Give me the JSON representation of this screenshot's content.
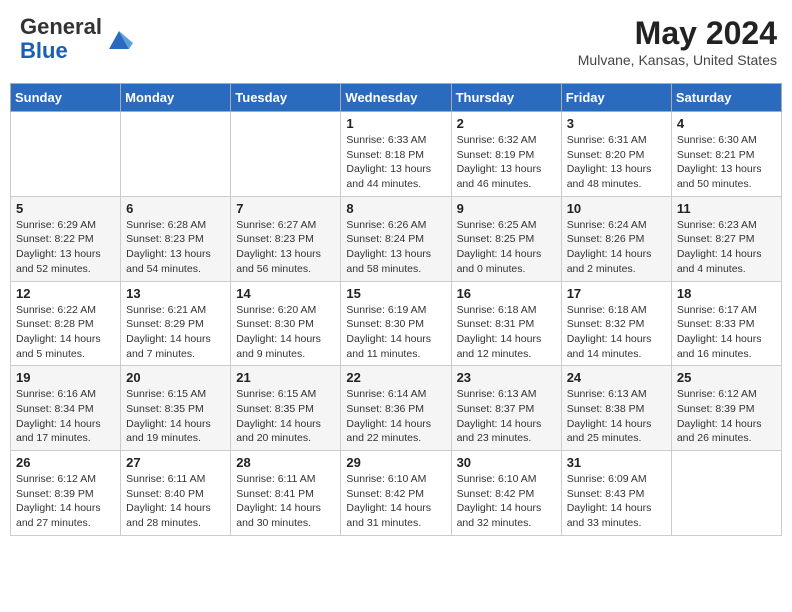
{
  "header": {
    "logo_general": "General",
    "logo_blue": "Blue",
    "month_year": "May 2024",
    "location": "Mulvane, Kansas, United States"
  },
  "weekdays": [
    "Sunday",
    "Monday",
    "Tuesday",
    "Wednesday",
    "Thursday",
    "Friday",
    "Saturday"
  ],
  "weeks": [
    [
      {
        "day": "",
        "info": ""
      },
      {
        "day": "",
        "info": ""
      },
      {
        "day": "",
        "info": ""
      },
      {
        "day": "1",
        "info": "Sunrise: 6:33 AM\nSunset: 8:18 PM\nDaylight: 13 hours\nand 44 minutes."
      },
      {
        "day": "2",
        "info": "Sunrise: 6:32 AM\nSunset: 8:19 PM\nDaylight: 13 hours\nand 46 minutes."
      },
      {
        "day": "3",
        "info": "Sunrise: 6:31 AM\nSunset: 8:20 PM\nDaylight: 13 hours\nand 48 minutes."
      },
      {
        "day": "4",
        "info": "Sunrise: 6:30 AM\nSunset: 8:21 PM\nDaylight: 13 hours\nand 50 minutes."
      }
    ],
    [
      {
        "day": "5",
        "info": "Sunrise: 6:29 AM\nSunset: 8:22 PM\nDaylight: 13 hours\nand 52 minutes."
      },
      {
        "day": "6",
        "info": "Sunrise: 6:28 AM\nSunset: 8:23 PM\nDaylight: 13 hours\nand 54 minutes."
      },
      {
        "day": "7",
        "info": "Sunrise: 6:27 AM\nSunset: 8:23 PM\nDaylight: 13 hours\nand 56 minutes."
      },
      {
        "day": "8",
        "info": "Sunrise: 6:26 AM\nSunset: 8:24 PM\nDaylight: 13 hours\nand 58 minutes."
      },
      {
        "day": "9",
        "info": "Sunrise: 6:25 AM\nSunset: 8:25 PM\nDaylight: 14 hours\nand 0 minutes."
      },
      {
        "day": "10",
        "info": "Sunrise: 6:24 AM\nSunset: 8:26 PM\nDaylight: 14 hours\nand 2 minutes."
      },
      {
        "day": "11",
        "info": "Sunrise: 6:23 AM\nSunset: 8:27 PM\nDaylight: 14 hours\nand 4 minutes."
      }
    ],
    [
      {
        "day": "12",
        "info": "Sunrise: 6:22 AM\nSunset: 8:28 PM\nDaylight: 14 hours\nand 5 minutes."
      },
      {
        "day": "13",
        "info": "Sunrise: 6:21 AM\nSunset: 8:29 PM\nDaylight: 14 hours\nand 7 minutes."
      },
      {
        "day": "14",
        "info": "Sunrise: 6:20 AM\nSunset: 8:30 PM\nDaylight: 14 hours\nand 9 minutes."
      },
      {
        "day": "15",
        "info": "Sunrise: 6:19 AM\nSunset: 8:30 PM\nDaylight: 14 hours\nand 11 minutes."
      },
      {
        "day": "16",
        "info": "Sunrise: 6:18 AM\nSunset: 8:31 PM\nDaylight: 14 hours\nand 12 minutes."
      },
      {
        "day": "17",
        "info": "Sunrise: 6:18 AM\nSunset: 8:32 PM\nDaylight: 14 hours\nand 14 minutes."
      },
      {
        "day": "18",
        "info": "Sunrise: 6:17 AM\nSunset: 8:33 PM\nDaylight: 14 hours\nand 16 minutes."
      }
    ],
    [
      {
        "day": "19",
        "info": "Sunrise: 6:16 AM\nSunset: 8:34 PM\nDaylight: 14 hours\nand 17 minutes."
      },
      {
        "day": "20",
        "info": "Sunrise: 6:15 AM\nSunset: 8:35 PM\nDaylight: 14 hours\nand 19 minutes."
      },
      {
        "day": "21",
        "info": "Sunrise: 6:15 AM\nSunset: 8:35 PM\nDaylight: 14 hours\nand 20 minutes."
      },
      {
        "day": "22",
        "info": "Sunrise: 6:14 AM\nSunset: 8:36 PM\nDaylight: 14 hours\nand 22 minutes."
      },
      {
        "day": "23",
        "info": "Sunrise: 6:13 AM\nSunset: 8:37 PM\nDaylight: 14 hours\nand 23 minutes."
      },
      {
        "day": "24",
        "info": "Sunrise: 6:13 AM\nSunset: 8:38 PM\nDaylight: 14 hours\nand 25 minutes."
      },
      {
        "day": "25",
        "info": "Sunrise: 6:12 AM\nSunset: 8:39 PM\nDaylight: 14 hours\nand 26 minutes."
      }
    ],
    [
      {
        "day": "26",
        "info": "Sunrise: 6:12 AM\nSunset: 8:39 PM\nDaylight: 14 hours\nand 27 minutes."
      },
      {
        "day": "27",
        "info": "Sunrise: 6:11 AM\nSunset: 8:40 PM\nDaylight: 14 hours\nand 28 minutes."
      },
      {
        "day": "28",
        "info": "Sunrise: 6:11 AM\nSunset: 8:41 PM\nDaylight: 14 hours\nand 30 minutes."
      },
      {
        "day": "29",
        "info": "Sunrise: 6:10 AM\nSunset: 8:42 PM\nDaylight: 14 hours\nand 31 minutes."
      },
      {
        "day": "30",
        "info": "Sunrise: 6:10 AM\nSunset: 8:42 PM\nDaylight: 14 hours\nand 32 minutes."
      },
      {
        "day": "31",
        "info": "Sunrise: 6:09 AM\nSunset: 8:43 PM\nDaylight: 14 hours\nand 33 minutes."
      },
      {
        "day": "",
        "info": ""
      }
    ]
  ]
}
